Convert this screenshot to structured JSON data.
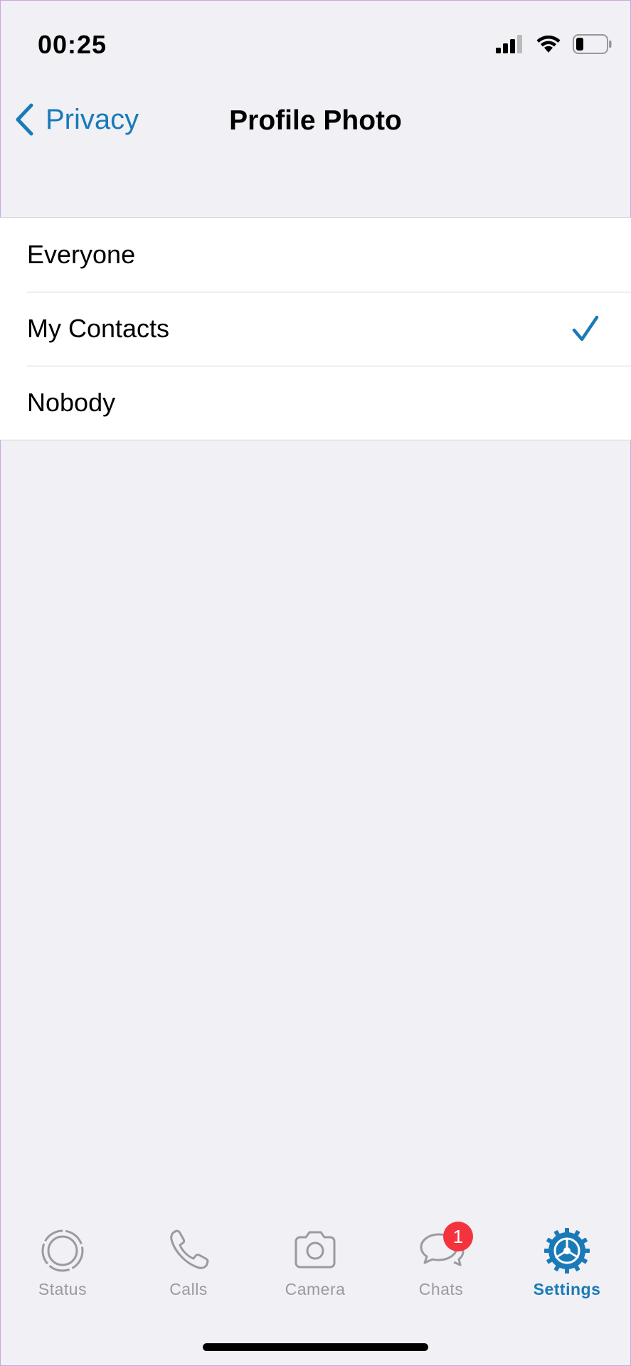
{
  "status_bar": {
    "time": "00:25",
    "icons": [
      "cellular-signal-icon",
      "wifi-icon",
      "battery-icon"
    ]
  },
  "nav": {
    "back_label": "Privacy",
    "title": "Profile Photo"
  },
  "options": [
    {
      "label": "Everyone",
      "selected": false
    },
    {
      "label": "My Contacts",
      "selected": true
    },
    {
      "label": "Nobody",
      "selected": false
    }
  ],
  "tabs": [
    {
      "label": "Status",
      "icon": "status-icon",
      "active": false
    },
    {
      "label": "Calls",
      "icon": "phone-icon",
      "active": false
    },
    {
      "label": "Camera",
      "icon": "camera-icon",
      "active": false
    },
    {
      "label": "Chats",
      "icon": "chats-icon",
      "active": false,
      "badge": "1"
    },
    {
      "label": "Settings",
      "icon": "gear-icon",
      "active": true
    }
  ],
  "colors": {
    "accent": "#1a7ab8",
    "background": "#f0f0f5",
    "inactive_tab": "#9a9a9f",
    "badge": "#f4333c"
  }
}
